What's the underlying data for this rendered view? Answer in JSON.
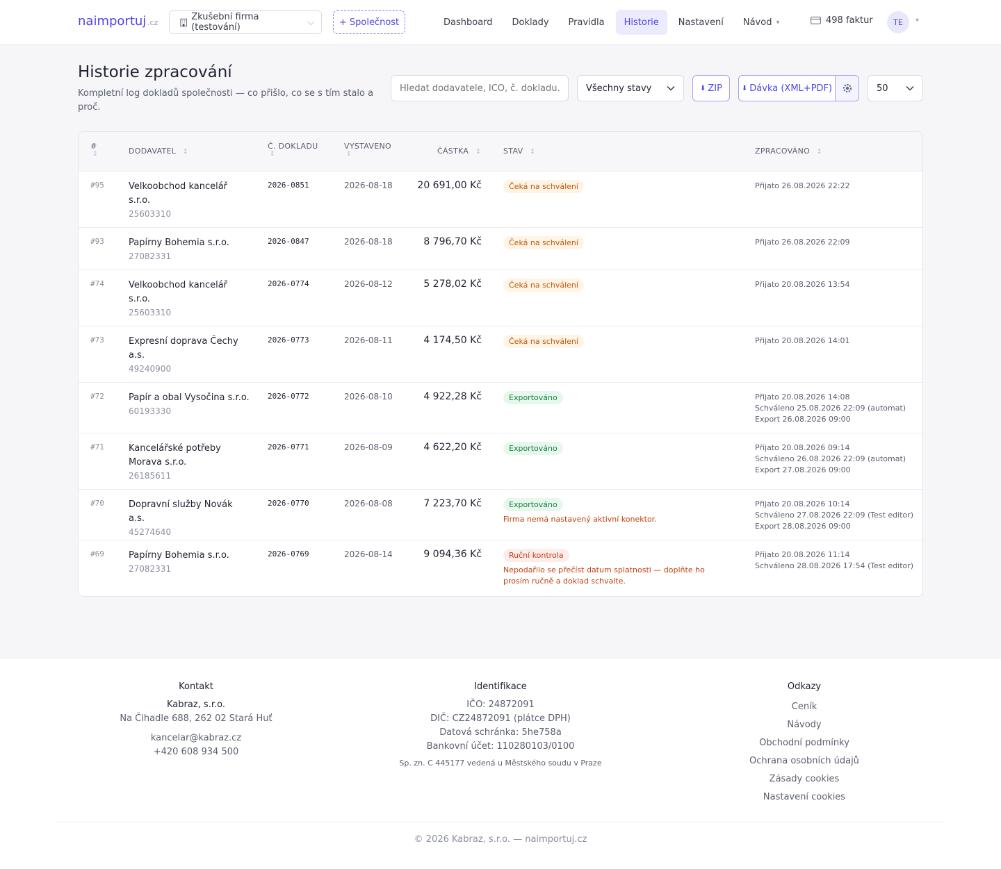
{
  "header": {
    "logo": "naimportuj",
    "logo_tld": ".cz",
    "company": "Zkušební firma (testování)",
    "add_company": "+ Společnost",
    "nav": [
      "Dashboard",
      "Doklady",
      "Pravidla",
      "Historie",
      "Nastavení",
      "Návod"
    ],
    "active_nav": "Historie",
    "credits": "498 faktur",
    "avatar": "TE",
    "accent_color": "#4f46e5"
  },
  "page": {
    "title": "Historie zpracování",
    "subtitle": "Kompletní log dokladů společnosti — co přišlo, co se s tím stalo a proč.",
    "search_placeholder": "Hledat dodavatele, IČO, č. dokladu…",
    "status_filter": "Všechny stavy",
    "zip_button": "ZIP",
    "batch_button": "Dávka (XML+PDF)",
    "page_size": "50"
  },
  "table": {
    "columns": [
      "#",
      "DODAVATEL",
      "Č. DOKLADU",
      "VYSTAVENO",
      "ČÁSTKA",
      "STAV",
      "ZPRACOVÁNO"
    ],
    "rows": [
      {
        "num": "#95",
        "supplier": "Velkoobchod kancelář s.r.o.",
        "ico": "25603310",
        "doc": "2026-0851",
        "date": "2026-08-18",
        "amount": "20 691,00 Kč",
        "status": "Čeká na schválení",
        "status_type": "wait",
        "note": "",
        "processed": [
          "Přijato 26.08.2026 22:22"
        ]
      },
      {
        "num": "#93",
        "supplier": "Papírny Bohemia s.r.o.",
        "ico": "27082331",
        "doc": "2026-0847",
        "date": "2026-08-18",
        "amount": "8 796,70 Kč",
        "status": "Čeká na schválení",
        "status_type": "wait",
        "note": "",
        "processed": [
          "Přijato 26.08.2026 22:09"
        ]
      },
      {
        "num": "#74",
        "supplier": "Velkoobchod kancelář s.r.o.",
        "ico": "25603310",
        "doc": "2026-0774",
        "date": "2026-08-12",
        "amount": "5 278,02 Kč",
        "status": "Čeká na schválení",
        "status_type": "wait",
        "note": "",
        "processed": [
          "Přijato 20.08.2026 13:54"
        ]
      },
      {
        "num": "#73",
        "supplier": "Expresní doprava Čechy a.s.",
        "ico": "49240900",
        "doc": "2026-0773",
        "date": "2026-08-11",
        "amount": "4 174,50 Kč",
        "status": "Čeká na schválení",
        "status_type": "wait",
        "note": "",
        "processed": [
          "Přijato 20.08.2026 14:01"
        ]
      },
      {
        "num": "#72",
        "supplier": "Papír a obal Vysočina s.r.o.",
        "ico": "60193330",
        "doc": "2026-0772",
        "date": "2026-08-10",
        "amount": "4 922,28 Kč",
        "status": "Exportováno",
        "status_type": "exported",
        "note": "",
        "processed": [
          "Přijato 20.08.2026 14:08",
          "Schváleno 25.08.2026 22:09 (automat)",
          "Export 26.08.2026 09:00"
        ]
      },
      {
        "num": "#71",
        "supplier": "Kancelářské potřeby Morava s.r.o.",
        "ico": "26185611",
        "doc": "2026-0771",
        "date": "2026-08-09",
        "amount": "4 622,20 Kč",
        "status": "Exportováno",
        "status_type": "exported",
        "note": "",
        "processed": [
          "Přijato 20.08.2026 09:14",
          "Schváleno 26.08.2026 22:09 (automat)",
          "Export 27.08.2026 09:00"
        ]
      },
      {
        "num": "#70",
        "supplier": "Dopravní služby Novák a.s.",
        "ico": "45274640",
        "doc": "2026-0770",
        "date": "2026-08-08",
        "amount": "7 223,70 Kč",
        "status": "Exportováno",
        "status_type": "exported",
        "note": "Firma nemá nastavený aktivní konektor.",
        "processed": [
          "Přijato 20.08.2026 10:14",
          "Schváleno 27.08.2026 22:09 (Test editor)",
          "Export 28.08.2026 09:00"
        ]
      },
      {
        "num": "#69",
        "supplier": "Papírny Bohemia s.r.o.",
        "ico": "27082331",
        "doc": "2026-0769",
        "date": "2026-08-14",
        "amount": "9 094,36 Kč",
        "status": "Ruční kontrola",
        "status_type": "manual",
        "note": "Nepodařilo se přečíst datum splatnosti — doplňte ho prosím ručně a doklad schvalte.",
        "processed": [
          "Přijato 20.08.2026 11:14",
          "Schváleno 28.08.2026 17:54 (Test editor)"
        ]
      }
    ]
  },
  "footer": {
    "contact": {
      "title": "Kontakt",
      "company": "Kabraz, s.r.o.",
      "address": "Na Čihadle 688, 262 02 Stará Huť",
      "email": "kancelar@kabraz.cz",
      "phone": "+420 608 934 500"
    },
    "ident": {
      "title": "Identifikace",
      "ico": "IČO: 24872091",
      "dic": "DIČ: CZ24872091 (plátce DPH)",
      "databox": "Datová schránka: 5he758a",
      "bank": "Bankovní účet: 110280103/0100",
      "register": "Sp. zn. C 445177 vedená u Městského soudu v Praze"
    },
    "links": {
      "title": "Odkazy",
      "items": [
        "Ceník",
        "Návody",
        "Obchodní podmínky",
        "Ochrana osobních údajů",
        "Zásady cookies",
        "Nastavení cookies"
      ]
    },
    "copyright": "© 2026 Kabraz, s.r.o. — naimportuj.cz"
  }
}
